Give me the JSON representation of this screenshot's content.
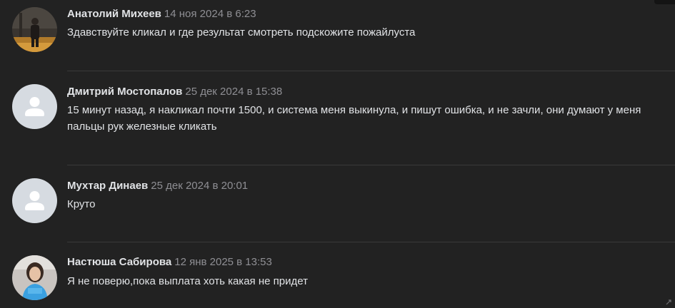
{
  "comments": [
    {
      "author": "Анатолий Михеев",
      "date": "14 ноя 2024 в 6:23",
      "text": "Здавствуйте кликал и где результат смотреть подскожите пожайлуста",
      "avatar": "photo-man"
    },
    {
      "author": "Дмитрий Мостопалов",
      "date": "25 дек 2024 в 15:38",
      "text": "15 минут назад, я накликал почти 1500, и система меня выкинула, и пишут ошибка, и не зачли, они думают у меня пальцы рук железные кликать",
      "avatar": "default-user-icon"
    },
    {
      "author": "Мухтар Динаев",
      "date": "25 дек 2024 в 20:01",
      "text": "Круто",
      "avatar": "default-user-icon"
    },
    {
      "author": "Настюша Сабирова",
      "date": "12 янв 2025 в 13:53",
      "text": "Я не поверю,пока выплата хоть какая не придет",
      "avatar": "photo-woman"
    }
  ],
  "colors": {
    "background": "#222222",
    "author": "#e1e3e6",
    "date": "#8f8f94",
    "text": "#e1e3e6",
    "divider": "#3a3a3a",
    "default_avatar_bg": "#d6dbe1"
  }
}
